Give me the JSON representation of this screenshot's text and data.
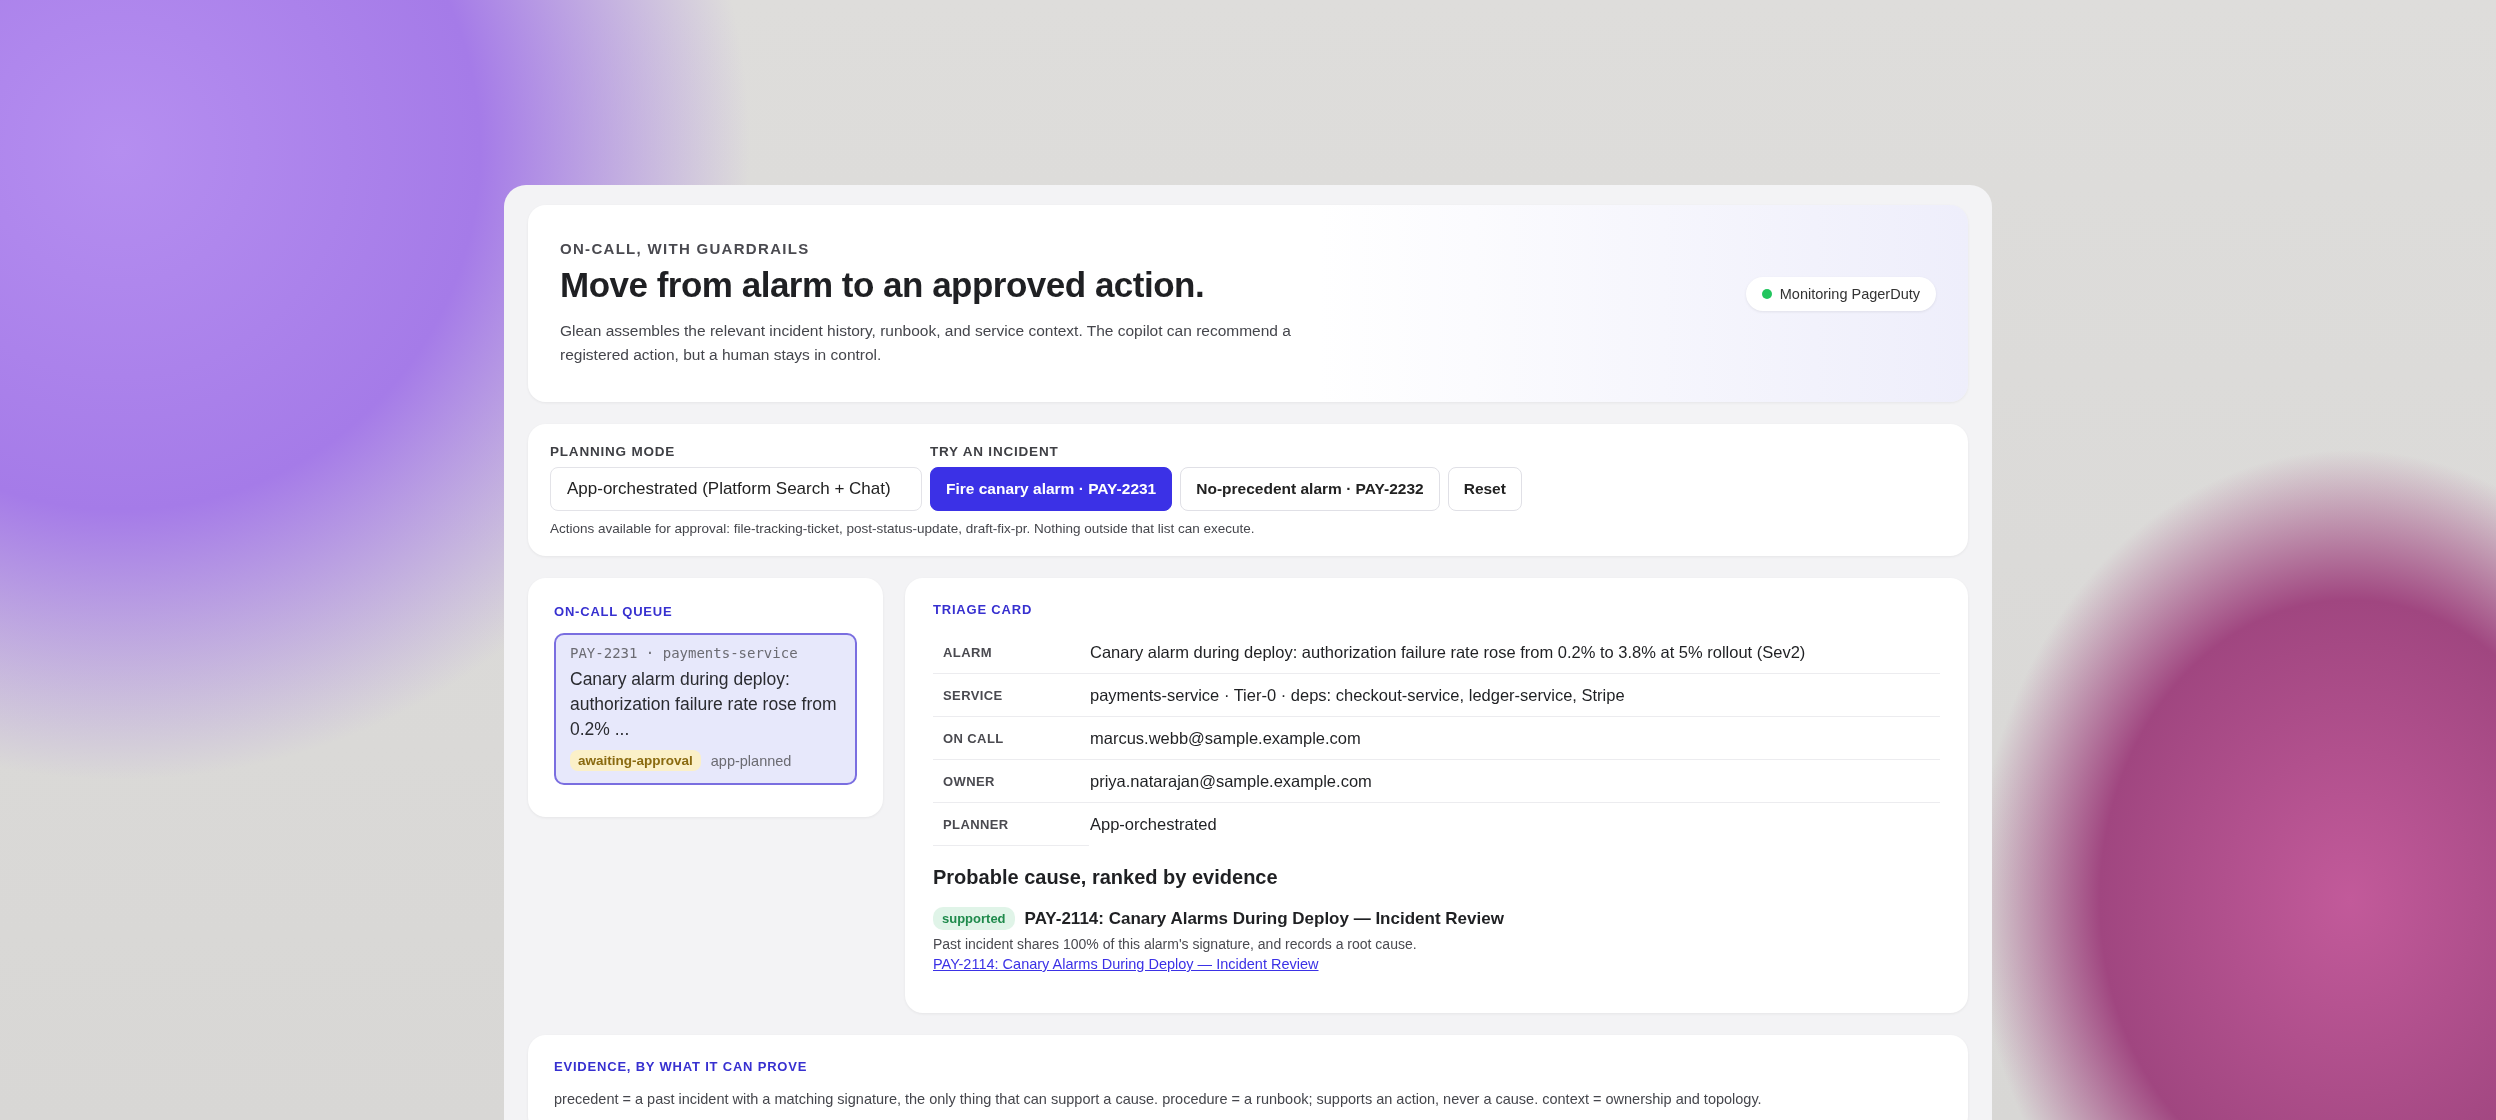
{
  "header": {
    "eyebrow": "ON-CALL, WITH GUARDRAILS",
    "title": "Move from alarm to an approved action.",
    "description": "Glean assembles the relevant incident history, runbook, and service context. The copilot can recommend a registered action, but a human stays in control.",
    "status": {
      "label": "Monitoring PagerDuty",
      "color": "#22c55e"
    }
  },
  "controls": {
    "planning_mode": {
      "label": "PLANNING MODE",
      "value": "App-orchestrated (Platform Search + Chat)"
    },
    "incident_label": "TRY AN INCIDENT",
    "incidents": [
      {
        "label": "Fire canary alarm · PAY-2231",
        "selected": true
      },
      {
        "label": "No-precedent alarm · PAY-2232",
        "selected": false
      }
    ],
    "reset": "Reset",
    "note": "Actions available for approval: file-tracking-ticket, post-status-update, draft-fix-pr. Nothing outside that list can execute."
  },
  "queue": {
    "title": "ON-CALL QUEUE",
    "items": [
      {
        "meta": "PAY-2231 · payments-service",
        "summary": "Canary alarm during deploy: authorization failure rate rose from 0.2% ...",
        "status": "awaiting-approval",
        "planner": "app-planned",
        "selected": true
      }
    ]
  },
  "triage": {
    "title": "TRIAGE CARD",
    "rows": [
      {
        "label": "ALARM",
        "value": "Canary alarm during deploy: authorization failure rate rose from 0.2% to 3.8% at 5% rollout (Sev2)"
      },
      {
        "label": "SERVICE",
        "value": "payments-service · Tier-0 · deps: checkout-service, ledger-service, Stripe"
      },
      {
        "label": "ON CALL",
        "value": "marcus.webb@sample.example.com"
      },
      {
        "label": "OWNER",
        "value": "priya.natarajan@sample.example.com"
      },
      {
        "label": "PLANNER",
        "value": "App-orchestrated"
      }
    ],
    "cause_heading": "Probable cause, ranked by evidence",
    "causes": [
      {
        "badge": "supported",
        "title": "PAY-2114: Canary Alarms During Deploy — Incident Review",
        "reason": "Past incident shares 100% of this alarm's signature, and records a root cause.",
        "link": "PAY-2114: Canary Alarms During Deploy — Incident Review"
      }
    ]
  },
  "evidence": {
    "title": "EVIDENCE, BY WHAT IT CAN PROVE",
    "text": "precedent = a past incident with a matching signature, the only thing that can support a cause. procedure = a runbook; supports an action, never a cause. context = ownership and topology."
  }
}
